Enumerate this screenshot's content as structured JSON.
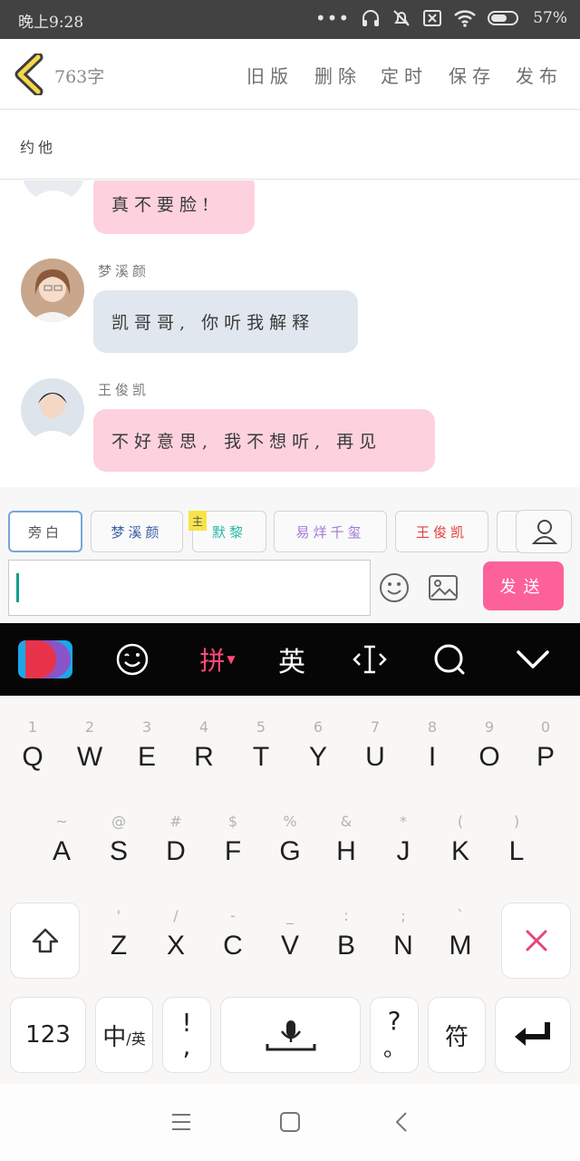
{
  "status_bar": {
    "time": "晚上9:28",
    "battery_percent": "57%",
    "icons": [
      "more-dots-icon",
      "headset-icon",
      "mute-bell-icon",
      "sim-off-icon",
      "wifi-icon",
      "battery-icon"
    ]
  },
  "header": {
    "word_count": "763字",
    "actions": [
      "旧版",
      "删除",
      "定时",
      "保存",
      "发布"
    ]
  },
  "title": {
    "value": "约他"
  },
  "chat": {
    "messages": [
      {
        "sender": "",
        "text": "真不要脸!",
        "bubble": "pink",
        "avatar": "boy-avatar"
      },
      {
        "sender": "梦溪颜",
        "text": "凯哥哥, 你听我解释",
        "bubble": "grey",
        "avatar": "girl-avatar"
      },
      {
        "sender": "王俊凯",
        "text": "不好意思, 我不想听, 再见",
        "bubble": "pink",
        "avatar": "boy-avatar"
      }
    ]
  },
  "roles": {
    "items": [
      {
        "label": "旁白",
        "color": "#555555"
      },
      {
        "label": "梦溪颜",
        "color": "#3b5fa6"
      },
      {
        "label": "默黎",
        "color": "#2bb7a6"
      },
      {
        "label": "易烊千玺",
        "color": "#a178d6"
      },
      {
        "label": "王俊凯",
        "color": "#e0413e"
      }
    ],
    "host_tag": "主",
    "input_value": "",
    "send_label": "发送"
  },
  "ime": {
    "pinyin_label": "拼",
    "english_label": "英"
  },
  "keyboard": {
    "row1": [
      {
        "main": "Q",
        "hint": "1"
      },
      {
        "main": "W",
        "hint": "2"
      },
      {
        "main": "E",
        "hint": "3"
      },
      {
        "main": "R",
        "hint": "4"
      },
      {
        "main": "T",
        "hint": "5"
      },
      {
        "main": "Y",
        "hint": "6"
      },
      {
        "main": "U",
        "hint": "7"
      },
      {
        "main": "I",
        "hint": "8"
      },
      {
        "main": "O",
        "hint": "9"
      },
      {
        "main": "P",
        "hint": "0"
      }
    ],
    "row2": [
      {
        "main": "A",
        "hint": "~"
      },
      {
        "main": "S",
        "hint": "@"
      },
      {
        "main": "D",
        "hint": "#"
      },
      {
        "main": "F",
        "hint": "$"
      },
      {
        "main": "G",
        "hint": "%"
      },
      {
        "main": "H",
        "hint": "&"
      },
      {
        "main": "J",
        "hint": "*"
      },
      {
        "main": "K",
        "hint": "("
      },
      {
        "main": "L",
        "hint": ")"
      }
    ],
    "row3": [
      {
        "main": "Z",
        "hint": "'"
      },
      {
        "main": "X",
        "hint": "/"
      },
      {
        "main": "C",
        "hint": "-"
      },
      {
        "main": "V",
        "hint": "_"
      },
      {
        "main": "B",
        "hint": ":"
      },
      {
        "main": "N",
        "hint": ";"
      },
      {
        "main": "M",
        "hint": "`"
      }
    ],
    "num_label": "123",
    "zh_label": "中",
    "en_small": "/英",
    "excl": "!",
    "comma": ",",
    "question": "?",
    "period": "。",
    "symbol_label": "符"
  }
}
